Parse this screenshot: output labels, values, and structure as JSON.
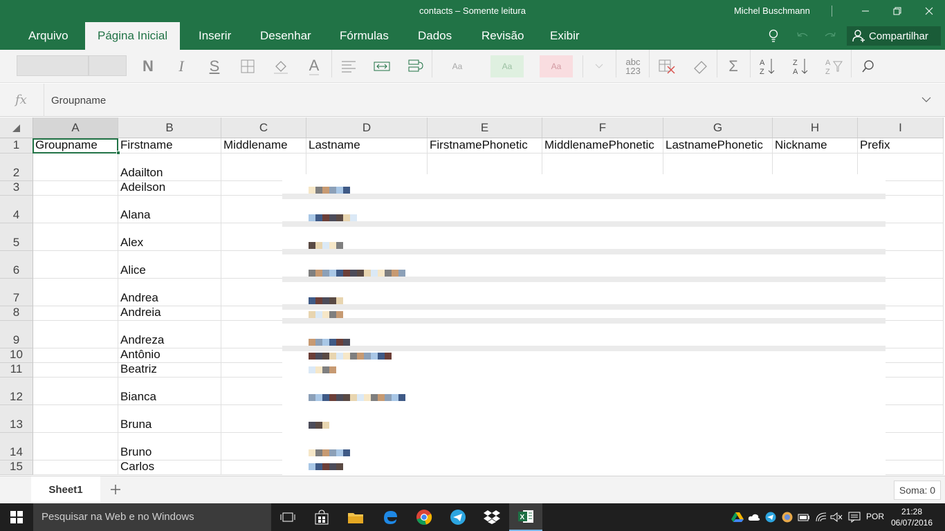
{
  "window": {
    "title": "contacts – Somente leitura",
    "user": "Michel Buschmann"
  },
  "ribbon": {
    "tabs": [
      "Arquivo",
      "Página Inicial",
      "Inserir",
      "Desenhar",
      "Fórmulas",
      "Dados",
      "Revisão",
      "Exibir"
    ],
    "active_tab": "Página Inicial",
    "share_label": "Compartilhar"
  },
  "toolbar": {
    "bold": "N",
    "italic": "I",
    "strike": "S",
    "font_color": "A",
    "style_samples": [
      "Aa",
      "Aa",
      "Aa"
    ],
    "number_format": "abc 123",
    "sum": "Σ"
  },
  "formula_bar": {
    "fx_label": "fx",
    "value": "Groupname"
  },
  "grid": {
    "columns": [
      "A",
      "B",
      "C",
      "D",
      "E",
      "F",
      "G",
      "H",
      "I"
    ],
    "selected_column": "A",
    "header_row": [
      "Groupname",
      "Firstname",
      "Middlename",
      "Lastname",
      "FirstnamePhonetic",
      "MiddlenamePhonetic",
      "LastnamePhonetic",
      "Nickname",
      "Prefix"
    ],
    "rows": [
      {
        "num": "1"
      },
      {
        "num": "2",
        "firstname": "Adailton"
      },
      {
        "num": "3",
        "firstname": "Adeilson"
      },
      {
        "num": "4",
        "firstname": "Alana"
      },
      {
        "num": "5",
        "firstname": "Alex"
      },
      {
        "num": "6",
        "firstname": "Alice"
      },
      {
        "num": "7",
        "firstname": "Andrea"
      },
      {
        "num": "8",
        "firstname": "Andreia"
      },
      {
        "num": "9",
        "firstname": "Andreza"
      },
      {
        "num": "10",
        "firstname": "Antônio"
      },
      {
        "num": "11",
        "firstname": "Beatriz"
      },
      {
        "num": "12",
        "firstname": "Bianca"
      },
      {
        "num": "13",
        "firstname": "Bruna"
      },
      {
        "num": "14",
        "firstname": "Bruno"
      },
      {
        "num": "15",
        "firstname": "Carlos"
      }
    ]
  },
  "sheets": {
    "tabs": [
      "Sheet1"
    ],
    "status": "Soma: 0"
  },
  "taskbar": {
    "search_placeholder": "Pesquisar na Web e no Windows",
    "language": "POR",
    "time": "21:28",
    "date": "06/07/2016"
  },
  "colors": {
    "excel_green": "#217346",
    "taskbar": "#1f1f1f"
  }
}
